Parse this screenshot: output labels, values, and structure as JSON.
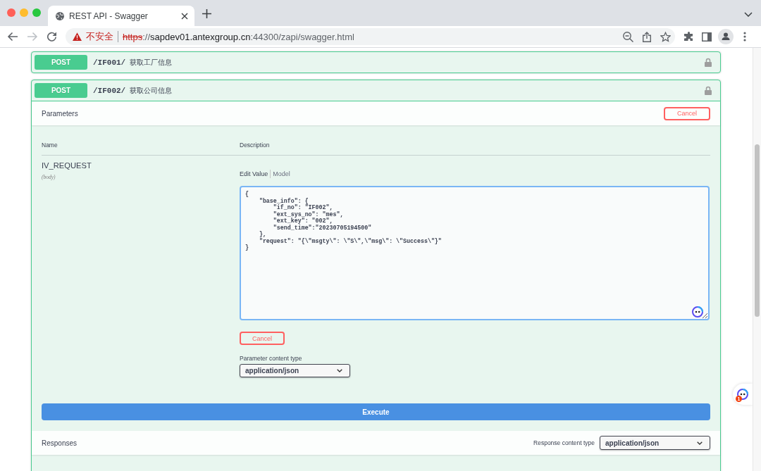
{
  "browser": {
    "tabs": [
      {
        "title": "REST API - Swagger",
        "selected": true
      }
    ],
    "nav_buttons": [
      {
        "kind": "back",
        "disabled": false
      },
      {
        "kind": "forward",
        "disabled": true
      },
      {
        "kind": "reload",
        "disabled": false
      }
    ],
    "address_bar": {
      "security_label": "不安全",
      "url": [
        {
          "kind": "scheme",
          "text": "https"
        },
        {
          "kind": "path",
          "text": "://"
        },
        {
          "kind": "host",
          "text": "sapdev01.antexgroup.cn"
        },
        {
          "kind": "path",
          "text": ":44300/zapi/swagger.html"
        }
      ]
    }
  },
  "operations": [
    {
      "method": "POST",
      "path": "/IF001/",
      "summary": "获取工厂信息",
      "expanded": false
    },
    {
      "method": "POST",
      "path": "/IF002/",
      "summary": "获取公司信息",
      "expanded": true,
      "parameters": {
        "title": "Parameters",
        "cancel_button": "Cancel",
        "columns": [
          "Name",
          "Description"
        ],
        "rows": [
          {
            "name": "IV_REQUEST",
            "location": "(body)",
            "tabs": [
              {
                "label": "Edit Value",
                "selected": true
              },
              {
                "label": "Model",
                "selected": false
              }
            ],
            "value": "{\n    \"base_info\": {\n        \"if_no\": \"IF002\",\n        \"ext_sys_no\": \"mes\",\n        \"ext_key\": \"002\",\n        \"send_time\":\"20230705194500\"\n    },\n    \"request\": \"{\\\"msgty\\\": \\\"S\\\",\\\"msg\\\": \\\"Success\\\"}\"\n}",
            "cancel_button": "Cancel",
            "content_type_label": "Parameter content type",
            "content_type": "application/json"
          }
        ]
      },
      "execute_button": "Execute",
      "responses": {
        "title": "Responses",
        "content_type_label": "Response content type",
        "content_type": "application/json"
      }
    }
  ],
  "side_widget": {
    "badge": "1"
  }
}
